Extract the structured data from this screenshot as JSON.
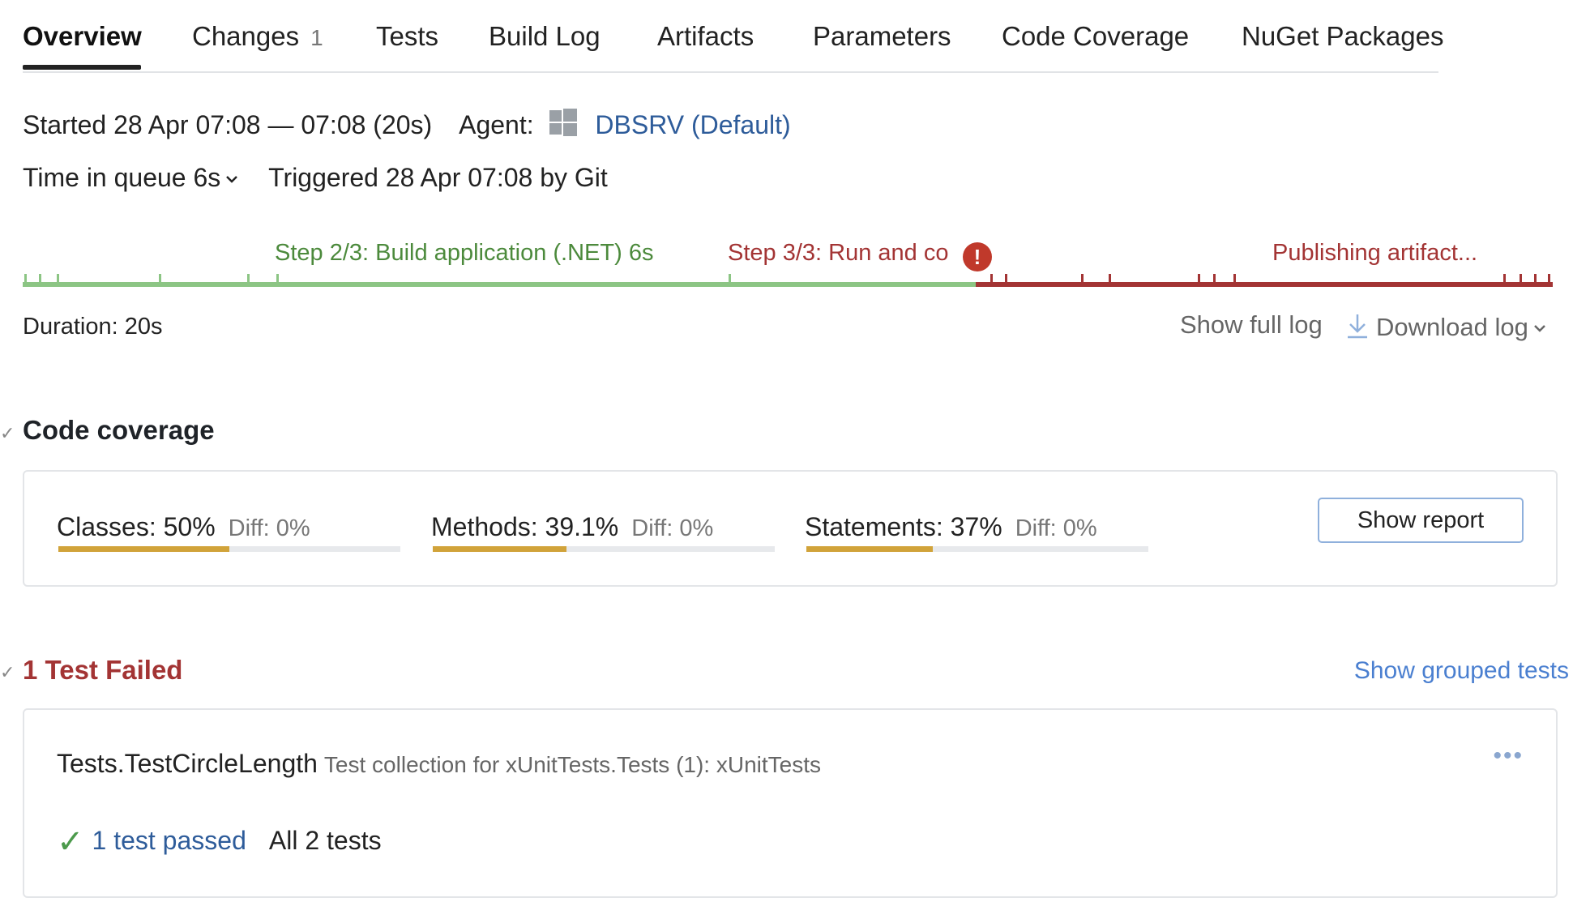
{
  "tabs": [
    {
      "label": "Overview",
      "active": true
    },
    {
      "label": "Changes",
      "count": "1"
    },
    {
      "label": "Tests"
    },
    {
      "label": "Build Log"
    },
    {
      "label": "Artifacts"
    },
    {
      "label": "Parameters"
    },
    {
      "label": "Code Coverage"
    },
    {
      "label": "NuGet Packages"
    }
  ],
  "info": {
    "started": "Started 28 Apr 07:08 — 07:08 (20s)",
    "agent_label": "Agent:",
    "agent_name": "DBSRV",
    "agent_pool": "(Default)",
    "queue": "Time in queue 6s",
    "triggered": "Triggered 28 Apr 07:08 by Git"
  },
  "timeline": {
    "step2": "Step 2/3: Build application (.NET) 6s",
    "step3": "Step 3/3: Run and co",
    "publishing": "Publishing artifact...",
    "error_mark": "!",
    "success_color": "#8cc584",
    "failure_color": "#a33434"
  },
  "duration": "Duration: 20s",
  "log": {
    "show_full": "Show full log",
    "download": "Download log"
  },
  "coverage": {
    "title": "Code coverage",
    "items": [
      {
        "label": "Classes: 50%",
        "diff": "Diff: 0%",
        "percent": 50
      },
      {
        "label": "Methods: 39.1%",
        "diff": "Diff: 0%",
        "percent": 39.1
      },
      {
        "label": "Statements: 37%",
        "diff": "Diff: 0%",
        "percent": 37
      }
    ],
    "show_report": "Show report",
    "bar_color": "#d1a33a"
  },
  "tests": {
    "title": "1 Test Failed",
    "show_grouped": "Show grouped tests",
    "test_name": "Tests.TestCircleLength",
    "collection": "Test collection for xUnitTests.Tests (1): xUnitTests",
    "passed": "1 test passed",
    "all": "All 2 tests",
    "more": "•••"
  }
}
